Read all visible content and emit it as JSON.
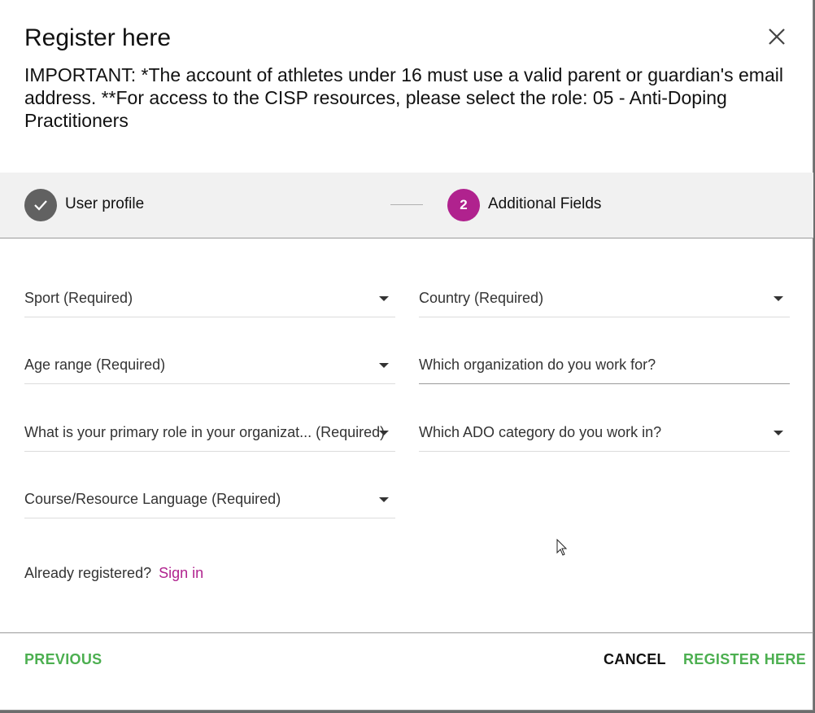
{
  "dialog": {
    "title": "Register here",
    "important": "IMPORTANT: *The account of athletes under 16 must use a valid parent or guardian's email address. **For access to the CISP resources, please select the role: 05 - Anti-Doping Practitioners"
  },
  "stepper": {
    "step1_label": "User profile",
    "step2_number": "2",
    "step2_label": "Additional Fields"
  },
  "fields": {
    "sport": "Sport (Required)",
    "country": "Country (Required)",
    "age_range": "Age range (Required)",
    "organization": "Which organization do you work for?",
    "primary_role": "What is your primary role in your organizat... (Required)",
    "ado_category": "Which ADO category do you work in?",
    "language": "Course/Resource Language (Required)"
  },
  "signin": {
    "prompt": "Already registered?",
    "link": "Sign in"
  },
  "footer": {
    "previous": "PREVIOUS",
    "cancel": "CANCEL",
    "register": "REGISTER HERE"
  },
  "colors": {
    "accent": "#b0228e",
    "action_green": "#4caf50",
    "step_done": "#616161"
  },
  "icons": {
    "close": "close-icon",
    "check": "check-icon",
    "caret": "chevron-down-icon"
  }
}
